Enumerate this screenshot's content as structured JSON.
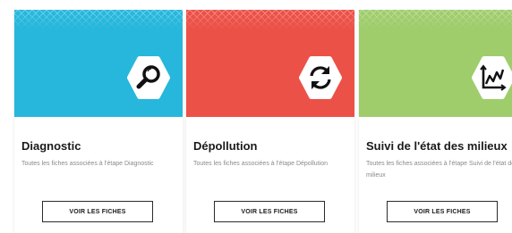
{
  "cards": [
    {
      "title": "Diagnostic",
      "description": "Toutes les fiches associées à l'étape Diagnostic",
      "button_label": "VOIR LES FICHES",
      "icon": "magnifier-icon",
      "color": "#27b7dc"
    },
    {
      "title": "Dépollution",
      "description": "Toutes les fiches associées à l'étape Dépollution",
      "button_label": "VOIR LES FICHES",
      "icon": "refresh-cycle-icon",
      "color": "#ec5148"
    },
    {
      "title": "Suivi de l'état des milieux",
      "description": "Toutes les fiches associées à l'étape Suivi de l'état des milieux",
      "button_label": "VOIR LES FICHES",
      "icon": "line-chart-icon",
      "color": "#9fcd6c"
    }
  ]
}
